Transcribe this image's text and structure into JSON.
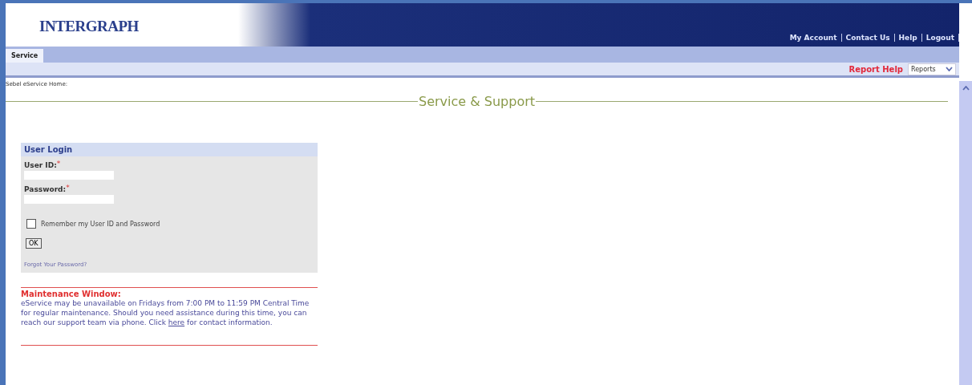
{
  "header": {
    "logo": "INTERGRAPH",
    "links": [
      "My Account",
      "Contact Us",
      "Help",
      "Logout"
    ]
  },
  "tabs": [
    {
      "label": "Service",
      "selected": true
    }
  ],
  "toolbar": {
    "help_link": "Report Help",
    "dropdown": "Reports"
  },
  "breadcrumb": "Sebel eService Home:",
  "page_title": "Service & Support",
  "login": {
    "title": "User Login",
    "fields": [
      {
        "label": "User ID:",
        "required_mark": "*"
      },
      {
        "label": "Password:",
        "required_mark": "*"
      }
    ],
    "remember": {
      "label": "Remember my User ID and Password",
      "checked": false
    },
    "button": "OK",
    "forgot_link": "Forgot Your Password?"
  },
  "notice": {
    "title": "Maintenance Window:",
    "text_before": "eService may be unavailable on Fridays from 7:00 PM to 11:59 PM Central Time for regular maintenance. Should you need assistance during this time, you can reach our support team via phone. Click",
    "link": "here",
    "text_after": "for contact information."
  }
}
